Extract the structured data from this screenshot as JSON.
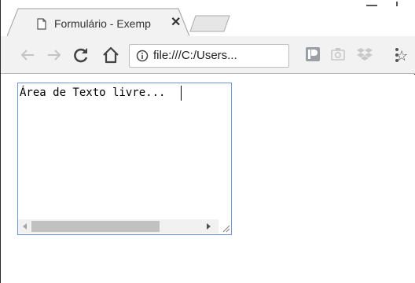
{
  "tab": {
    "title": "Formulário - Exemp",
    "close_glyph": "✕",
    "icon": "page-icon"
  },
  "toolbar": {
    "back_icon": "back-arrow-icon",
    "forward_icon": "forward-arrow-icon",
    "reload_icon": "reload-icon",
    "home_icon": "home-icon",
    "url": "file:///C:/Users...",
    "star_glyph": "☆",
    "extensions": [
      "pushbullet-icon",
      "screenshot-icon",
      "dropbox-icon"
    ],
    "menu_icon": "kebab-menu-icon"
  },
  "page": {
    "textarea_value": "Área de Texto livre..."
  },
  "colors": {
    "textarea_border": "#6f95d6",
    "toolbar_bg": "#f2f2f2"
  }
}
